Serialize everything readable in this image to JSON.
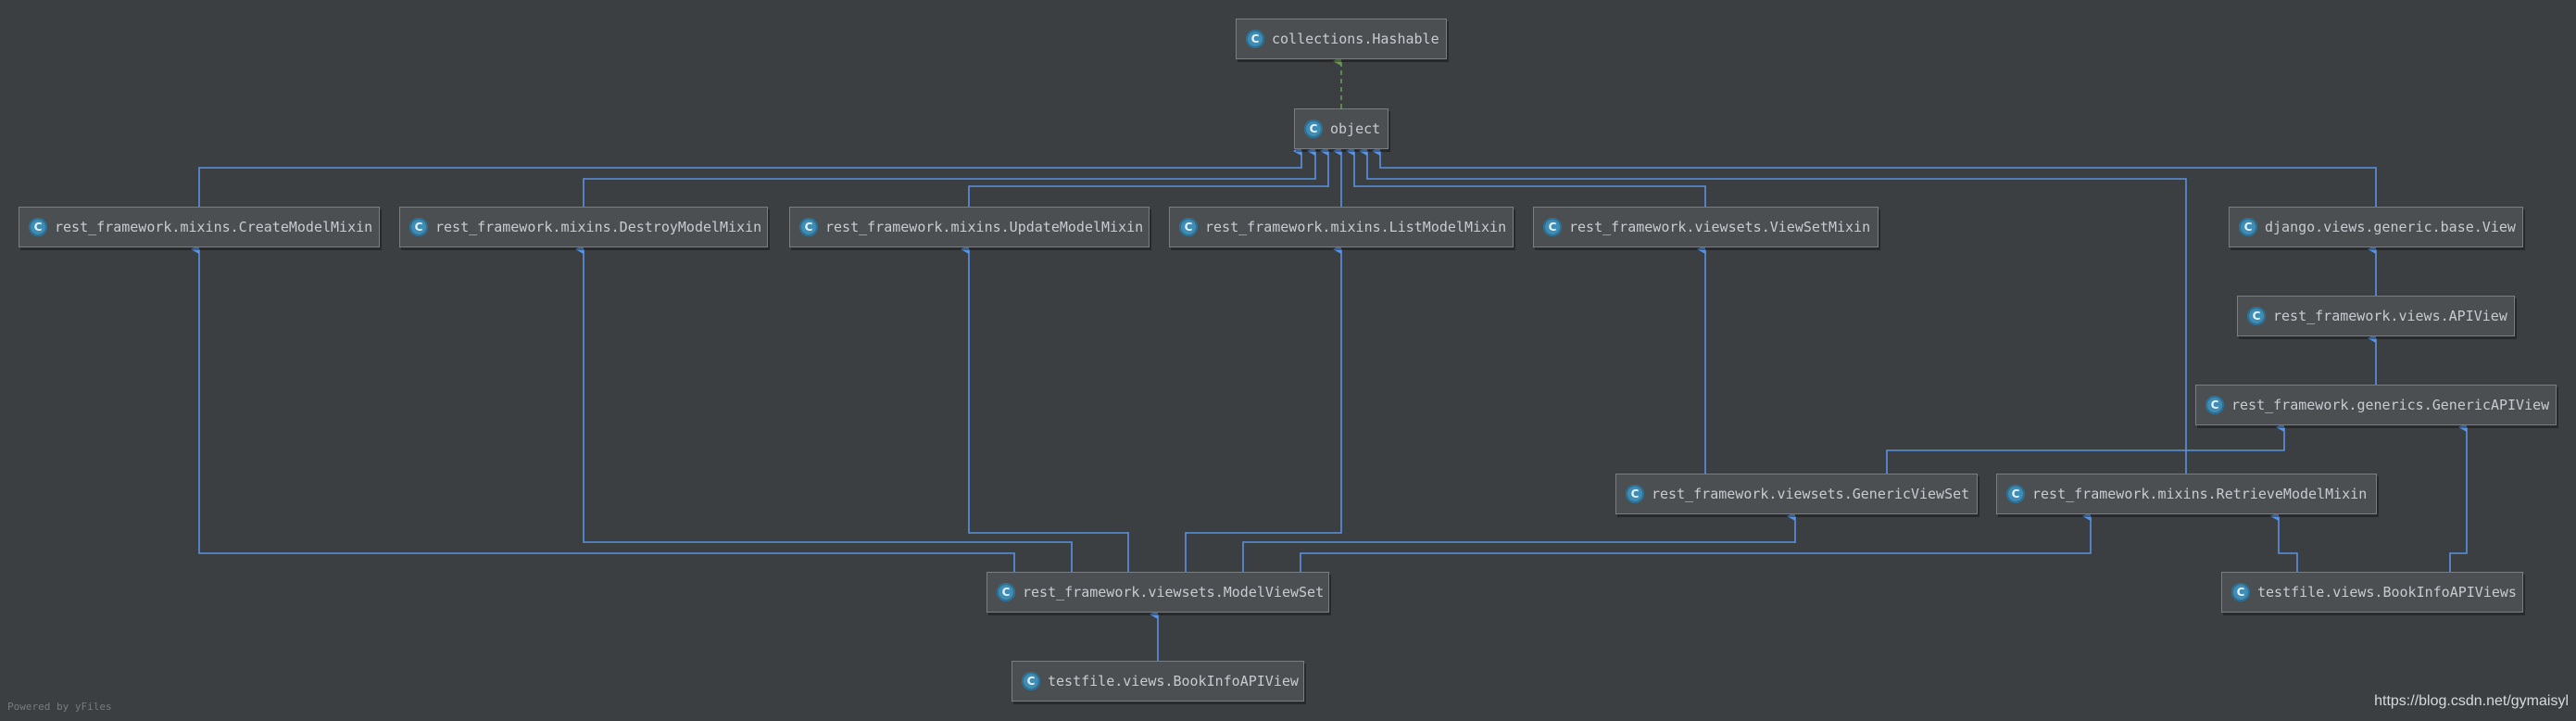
{
  "diagram": {
    "colors": {
      "inheritance": "#5a93e0",
      "implements": "#6a9955",
      "background": "#3c3f41"
    },
    "class_badge": "C",
    "nodes": [
      {
        "id": "hashable",
        "label": "collections.Hashable"
      },
      {
        "id": "object",
        "label": "object"
      },
      {
        "id": "create_mixin",
        "label": "rest_framework.mixins.CreateModelMixin"
      },
      {
        "id": "destroy_mixin",
        "label": "rest_framework.mixins.DestroyModelMixin"
      },
      {
        "id": "update_mixin",
        "label": "rest_framework.mixins.UpdateModelMixin"
      },
      {
        "id": "list_mixin",
        "label": "rest_framework.mixins.ListModelMixin"
      },
      {
        "id": "viewset_mixin",
        "label": "rest_framework.viewsets.ViewSetMixin"
      },
      {
        "id": "django_view",
        "label": "django.views.generic.base.View"
      },
      {
        "id": "apiview",
        "label": "rest_framework.views.APIView"
      },
      {
        "id": "generic_apiview",
        "label": "rest_framework.generics.GenericAPIView"
      },
      {
        "id": "generic_viewset",
        "label": "rest_framework.viewsets.GenericViewSet"
      },
      {
        "id": "retrieve_mixin",
        "label": "rest_framework.mixins.RetrieveModelMixin"
      },
      {
        "id": "model_viewset",
        "label": "rest_framework.viewsets.ModelViewSet"
      },
      {
        "id": "bookinfo_apiviews",
        "label": "testfile.views.BookInfoAPIViews"
      },
      {
        "id": "bookinfo_apiview",
        "label": "testfile.views.BookInfoAPIView"
      }
    ]
  },
  "footer": {
    "powered_by": "Powered by yFiles"
  },
  "watermark": "https://blog.csdn.net/gymaisyl"
}
